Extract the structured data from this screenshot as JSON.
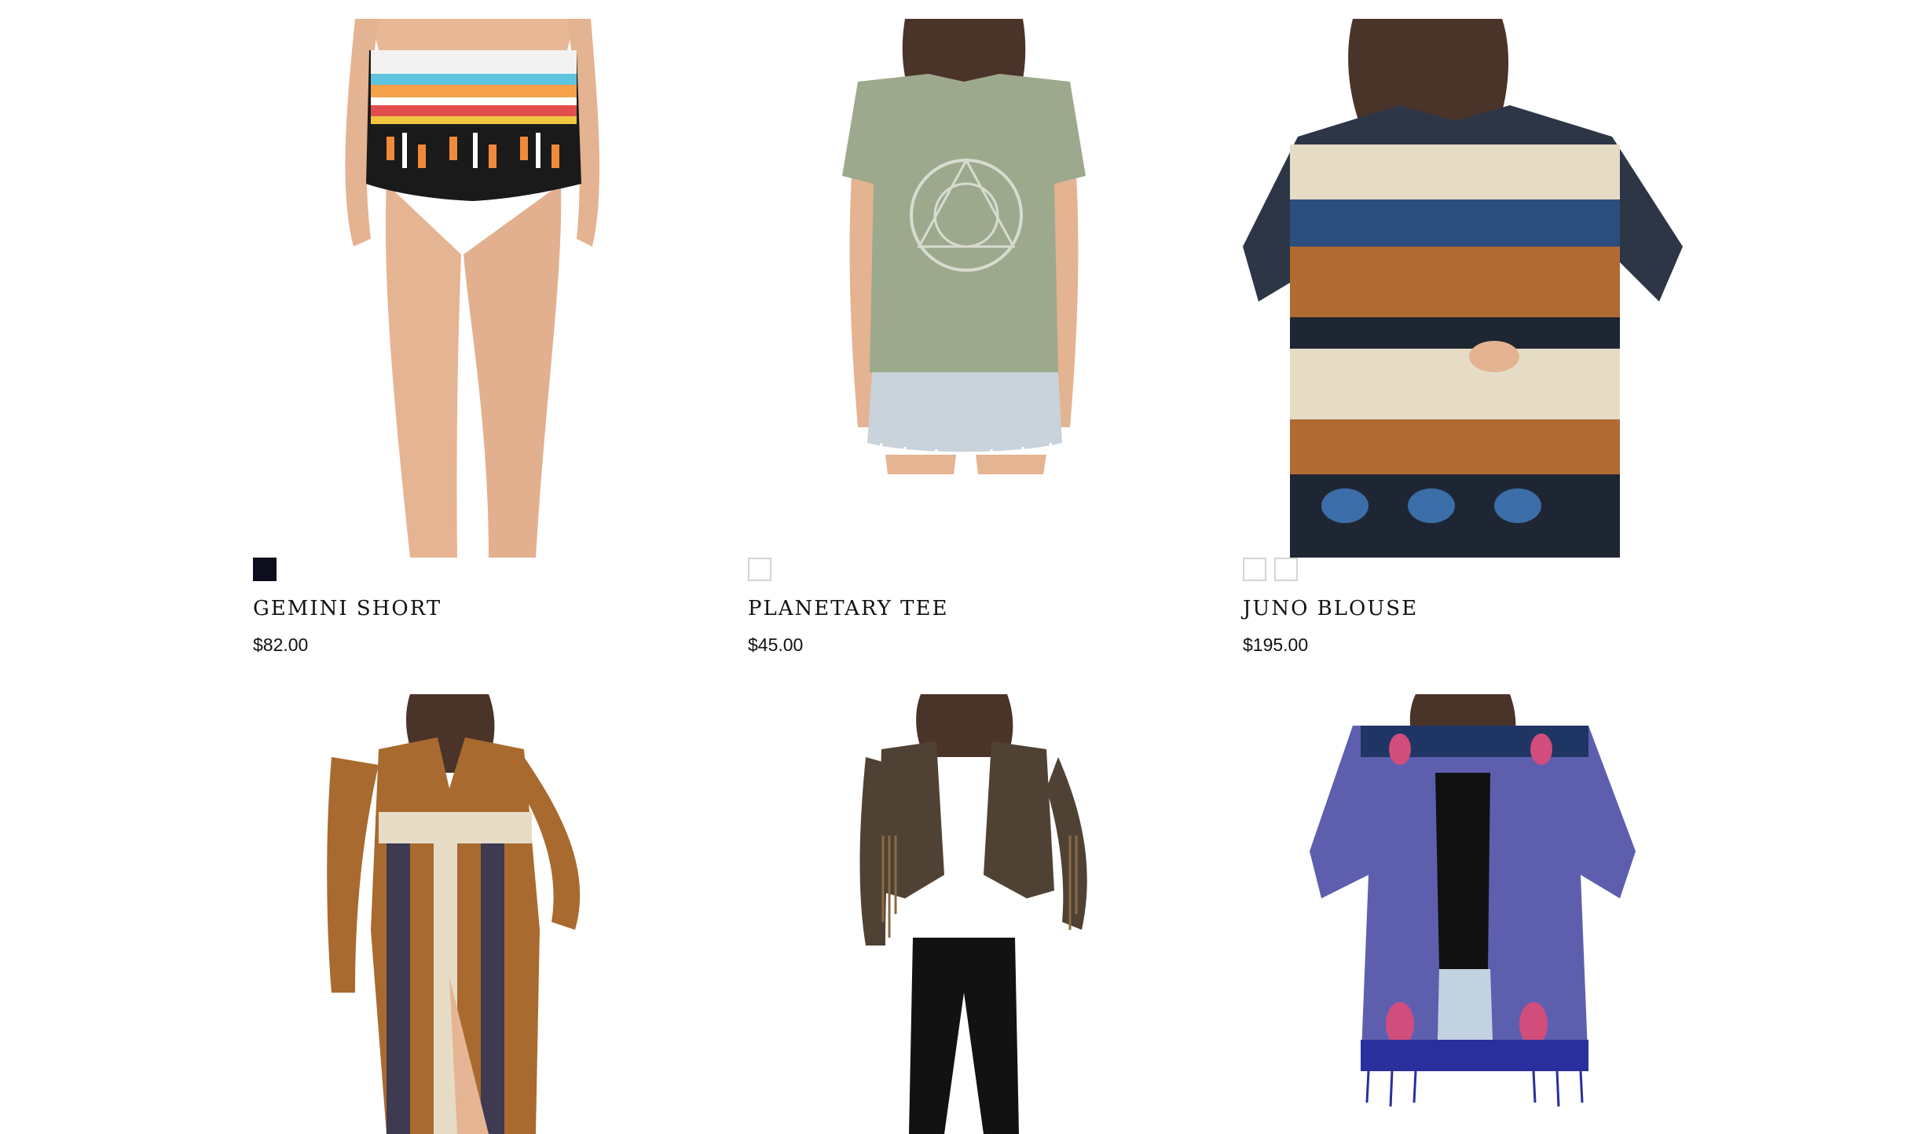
{
  "products": [
    {
      "name": "GEMINI SHORT",
      "price": "$82.00",
      "swatches": [
        "#0d0d1e"
      ]
    },
    {
      "name": "PLANETARY TEE",
      "price": "$45.00",
      "swatches": [
        "#ffffff"
      ]
    },
    {
      "name": "JUNO BLOUSE",
      "price": "$195.00",
      "swatches": [
        "#ffffff",
        "#ffffff"
      ]
    },
    {
      "name": "",
      "price": "",
      "swatches": []
    },
    {
      "name": "",
      "price": "",
      "swatches": []
    },
    {
      "name": "",
      "price": "",
      "swatches": []
    }
  ],
  "colors": {
    "background": "#ffffff",
    "text": "#111111",
    "swatch_border": "#d4d4d4",
    "skin": "#e8b896",
    "hair": "#4a3328"
  }
}
